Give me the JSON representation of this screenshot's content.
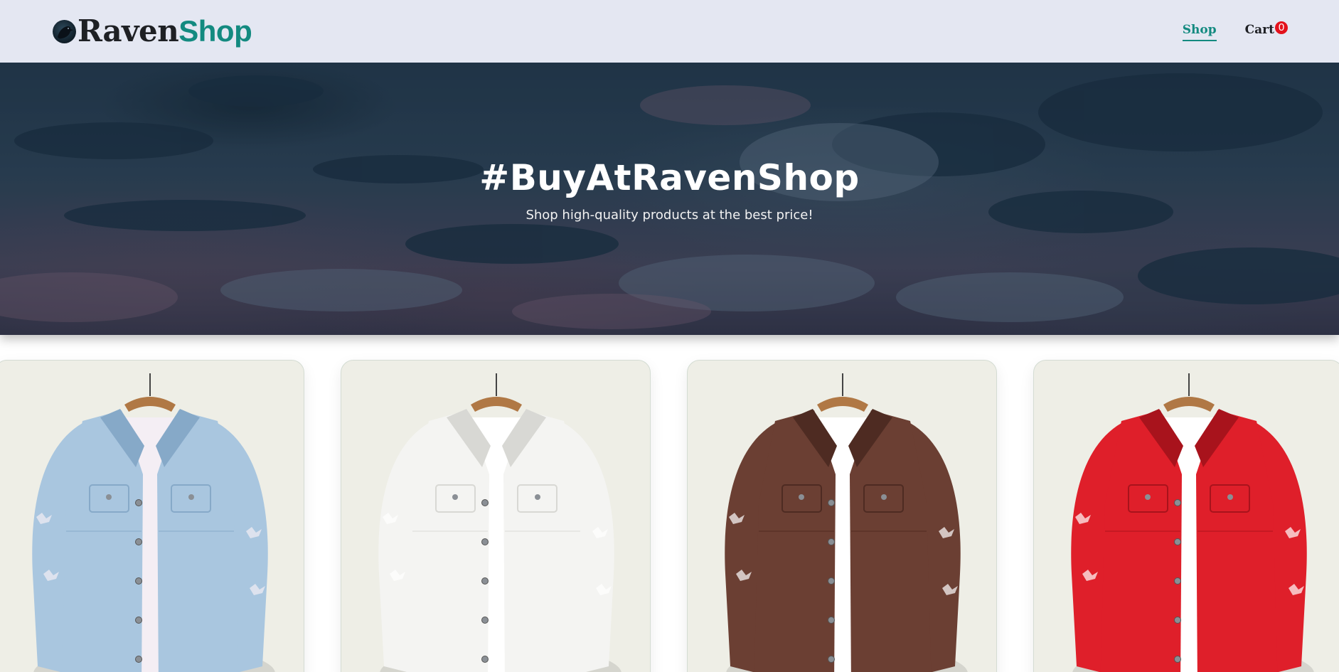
{
  "header": {
    "logo_raven": "Raven",
    "logo_shop": "Shop",
    "logo_icon": "raven-logo-icon",
    "nav": {
      "shop_label": "Shop",
      "cart_label": "Cart",
      "cart_count": "0"
    }
  },
  "hero": {
    "title": "#BuyAtRavenShop",
    "subtitle": "Shop high-quality products at the best price!"
  },
  "products": [
    {
      "color_name": "light-blue",
      "body": "#a9c6df",
      "shade": "#86a9c8",
      "inner": "#f4eef4"
    },
    {
      "color_name": "white",
      "body": "#f4f4f2",
      "shade": "#d8d8d4",
      "inner": "#ffffff"
    },
    {
      "color_name": "brown",
      "body": "#6b3f33",
      "shade": "#4e2b22",
      "inner": "#ffffff"
    },
    {
      "color_name": "red",
      "body": "#df1f2a",
      "shade": "#a8131c",
      "inner": "#ffffff"
    }
  ],
  "colors": {
    "header_bg": "#e4e7f2",
    "brand_dark": "#1e2024",
    "brand_teal": "#138a80",
    "badge_red": "#e3121c",
    "card_bg": "#eeeee6"
  }
}
